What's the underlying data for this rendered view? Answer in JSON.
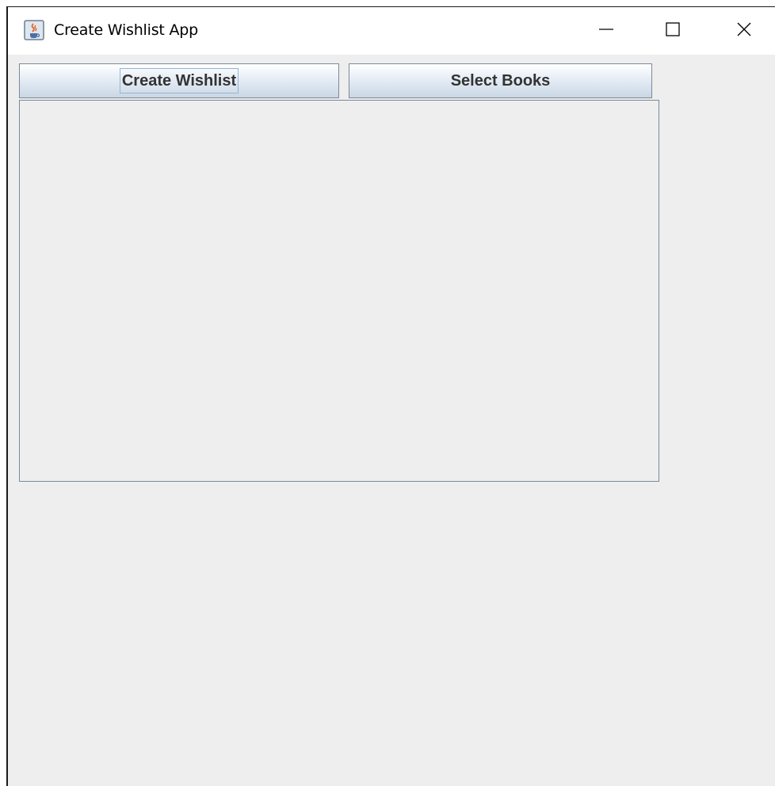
{
  "window": {
    "title": "Create Wishlist App",
    "icon": "java-cup-icon"
  },
  "controls": {
    "minimize_icon": "minimize-icon",
    "maximize_icon": "maximize-icon",
    "close_icon": "close-icon"
  },
  "toolbar": {
    "create_wishlist_label": "Create Wishlist",
    "select_books_label": "Select Books"
  },
  "colors": {
    "window_bg": "#eeeeee",
    "titlebar_bg": "#ffffff",
    "button_border": "#7a8a99",
    "button_text": "#333333"
  }
}
